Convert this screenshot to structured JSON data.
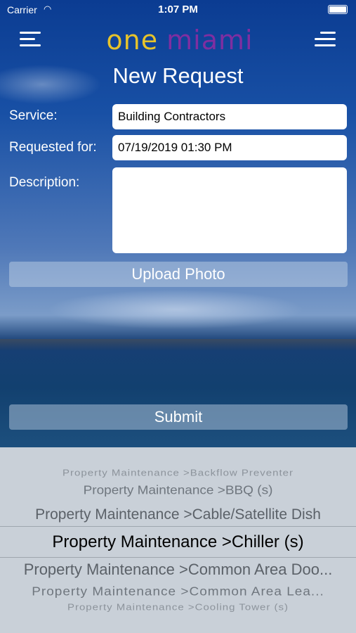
{
  "status_bar": {
    "carrier": "Carrier",
    "time": "1:07 PM"
  },
  "logo": {
    "one": "one",
    "miami": "miami"
  },
  "page_title": "New Request",
  "form": {
    "service_label": "Service:",
    "service_value": "Building Contractors",
    "requested_for_label": "Requested for:",
    "requested_for_value": "07/19/2019 01:30 PM",
    "description_label": "Description:",
    "description_value": ""
  },
  "upload_photo_label": "Upload Photo",
  "submit_label": "Submit",
  "picker": {
    "items": [
      "Property Maintenance >Backflow Preventer",
      "Property Maintenance >BBQ (s)",
      "Property Maintenance >Cable/Satellite Dish",
      "Property Maintenance >Chiller (s)",
      "Property Maintenance >Common Area Doo...",
      "Property Maintenance >Common Area Lea...",
      "Property Maintenance >Cooling Tower (s)"
    ],
    "selected": "Property Maintenance >Chiller (s)"
  },
  "colors": {
    "logo_one": "#e6c32b",
    "logo_miami": "#7f2ea1",
    "background": "#0d3b86",
    "picker_bg": "#c9d0d8"
  }
}
